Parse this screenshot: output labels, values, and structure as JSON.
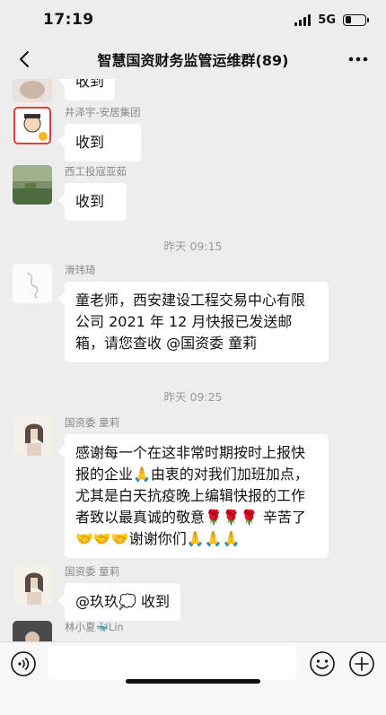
{
  "status_bar": {
    "time": "17:19",
    "network": "5G"
  },
  "header": {
    "title": "智慧国资财务监管运维群(89)"
  },
  "messages": [
    {
      "sender": "",
      "text": "收到"
    },
    {
      "sender": "井泽宇-安居集团",
      "text": "收到"
    },
    {
      "sender": "西工投寇亚茹",
      "text": "收到"
    },
    {
      "sender": "滑玮琦",
      "text": "童老师，西安建设工程交易中心有限公司 2021 年 12 月快报已发送邮箱，请您查收 @国资委  童莉"
    },
    {
      "sender": "国资委  童莉",
      "text": "感谢每一个在这非常时期按时上报快报的企业🙏由衷的对我们加班加点，尤其是白天抗疫晚上编辑快报的工作者致以最真诚的敬意🌹🌹🌹 辛苦了🤝🤝🤝谢谢你们🙏🙏🙏"
    },
    {
      "sender": "国资委  童莉",
      "text": "@玖玖💭 收到"
    },
    {
      "sender": "林小夏🐳Lin",
      "text": ""
    }
  ],
  "timestamps": [
    "昨天 09:15",
    "昨天 09:25"
  ],
  "icons": {
    "back": "chevron-left-icon",
    "more": "ellipsis-icon",
    "voice": "voice-icon",
    "emoji": "emoji-icon",
    "plus": "plus-icon"
  },
  "colors": {
    "background": "#ededed",
    "bubble": "#ffffff",
    "meta_text": "#888888"
  }
}
